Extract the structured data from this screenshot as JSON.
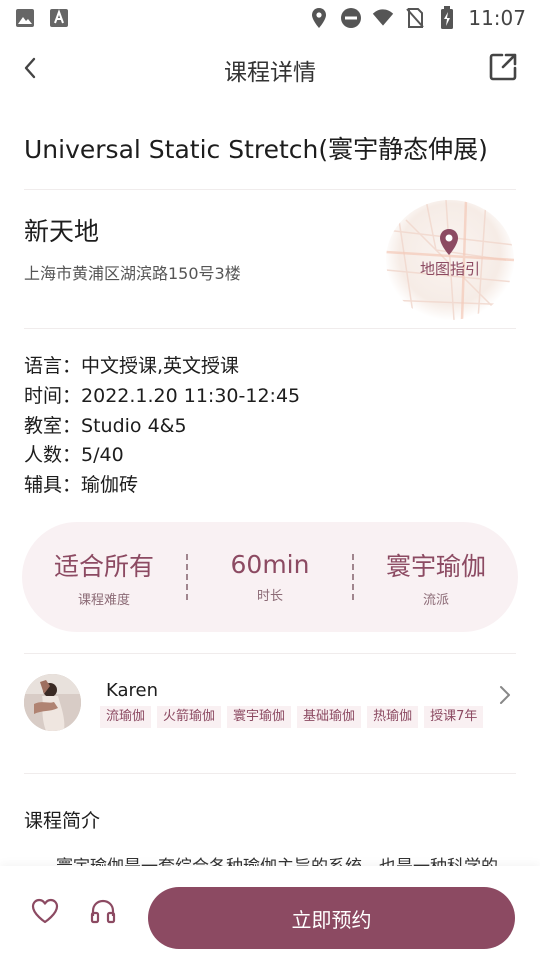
{
  "status_bar": {
    "time": "11:07"
  },
  "header": {
    "title": "课程详情"
  },
  "course": {
    "title": "Universal Static Stretch(寰宇静态伸展)"
  },
  "location": {
    "name": "新天地",
    "address": "上海市黄浦区湖滨路150号3楼",
    "map_label": "地图指引"
  },
  "info": [
    {
      "label": "语言：",
      "value": "中文授课,英文授课"
    },
    {
      "label": "时间：",
      "value": "2022.1.20 11:30-12:45"
    },
    {
      "label": "教室：",
      "value": "Studio 4&5"
    },
    {
      "label": "人数：",
      "value": "5/40"
    },
    {
      "label": "辅具：",
      "value": "瑜伽砖"
    }
  ],
  "stats": [
    {
      "value": "适合所有",
      "label": "课程难度"
    },
    {
      "value": "60min",
      "label": "时长"
    },
    {
      "value": "寰宇瑜伽",
      "label": "流派"
    }
  ],
  "teacher": {
    "name": "Karen",
    "tags": [
      "流瑜伽",
      "火箭瑜伽",
      "寰宇瑜伽",
      "基础瑜伽",
      "热瑜伽",
      "授课7年"
    ]
  },
  "intro": {
    "title": "课程简介",
    "text": "寰宇瑜伽是一套综合各种瑜伽主旨的系统，也是一种科学的"
  },
  "bottom": {
    "book_label": "立即预约"
  },
  "colors": {
    "accent": "#8c4a62",
    "stats_bg": "#f9f1f3",
    "tag_bg": "#f9f0f2"
  },
  "icons": [
    "image-icon",
    "text-icon",
    "location-icon",
    "dnd-icon",
    "wifi-icon",
    "no-sim-icon",
    "battery-icon",
    "back-arrow-icon",
    "share-icon",
    "map-pin-icon",
    "chevron-right-icon",
    "heart-icon",
    "headphones-icon"
  ]
}
